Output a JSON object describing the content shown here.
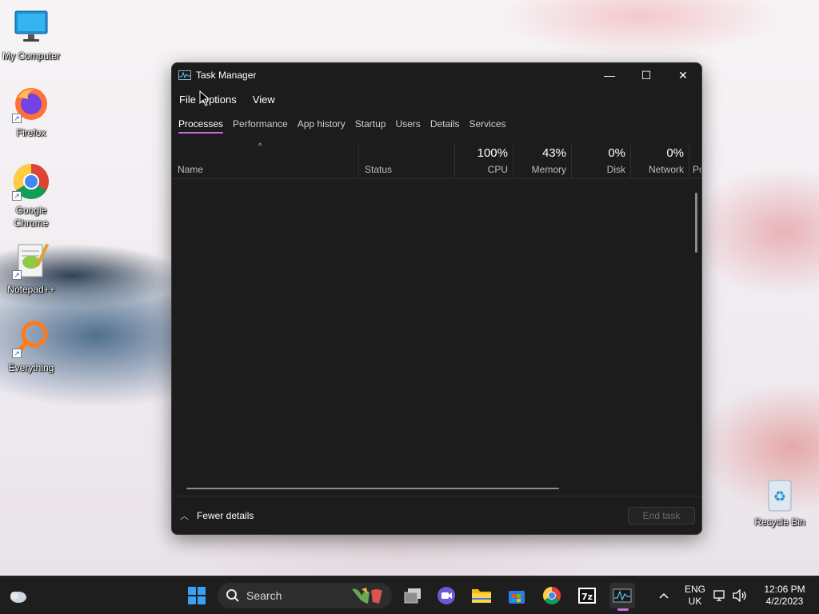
{
  "desktop": {
    "icons": [
      {
        "label": "My Computer"
      },
      {
        "label": "Firefox"
      },
      {
        "label": "Google Chrome"
      },
      {
        "label": "Notepad++"
      },
      {
        "label": "Everything"
      },
      {
        "label": "Recycle Bin"
      }
    ]
  },
  "window": {
    "title": "Task Manager",
    "controls": {
      "minimize": "—",
      "maximize": "☐",
      "close": "✕"
    },
    "menu": [
      "File",
      "Options",
      "View"
    ],
    "tabs": [
      {
        "label": "Processes",
        "active": true
      },
      {
        "label": "Performance"
      },
      {
        "label": "App history"
      },
      {
        "label": "Startup"
      },
      {
        "label": "Users"
      },
      {
        "label": "Details"
      },
      {
        "label": "Services"
      }
    ],
    "columns": {
      "name": "Name",
      "status": "Status",
      "cpu": {
        "label": "CPU",
        "percent": "100%"
      },
      "memory": {
        "label": "Memory",
        "percent": "43%"
      },
      "disk": {
        "label": "Disk",
        "percent": "0%"
      },
      "network": {
        "label": "Network",
        "percent": "0%"
      },
      "power": "Po"
    },
    "sort_indicator": "^",
    "footer": {
      "fewer_details": "Fewer details",
      "end_task": "End task"
    }
  },
  "taskbar": {
    "search_label": "Search",
    "language": {
      "line1": "ENG",
      "line2": "UK"
    },
    "clock": {
      "time": "12:06 PM",
      "date": "4/2/2023"
    },
    "overflow": "^"
  },
  "colors": {
    "accent": "#c86fe0",
    "window_bg": "#1c1c1c",
    "taskbar_bg": "#1e1e1e"
  }
}
